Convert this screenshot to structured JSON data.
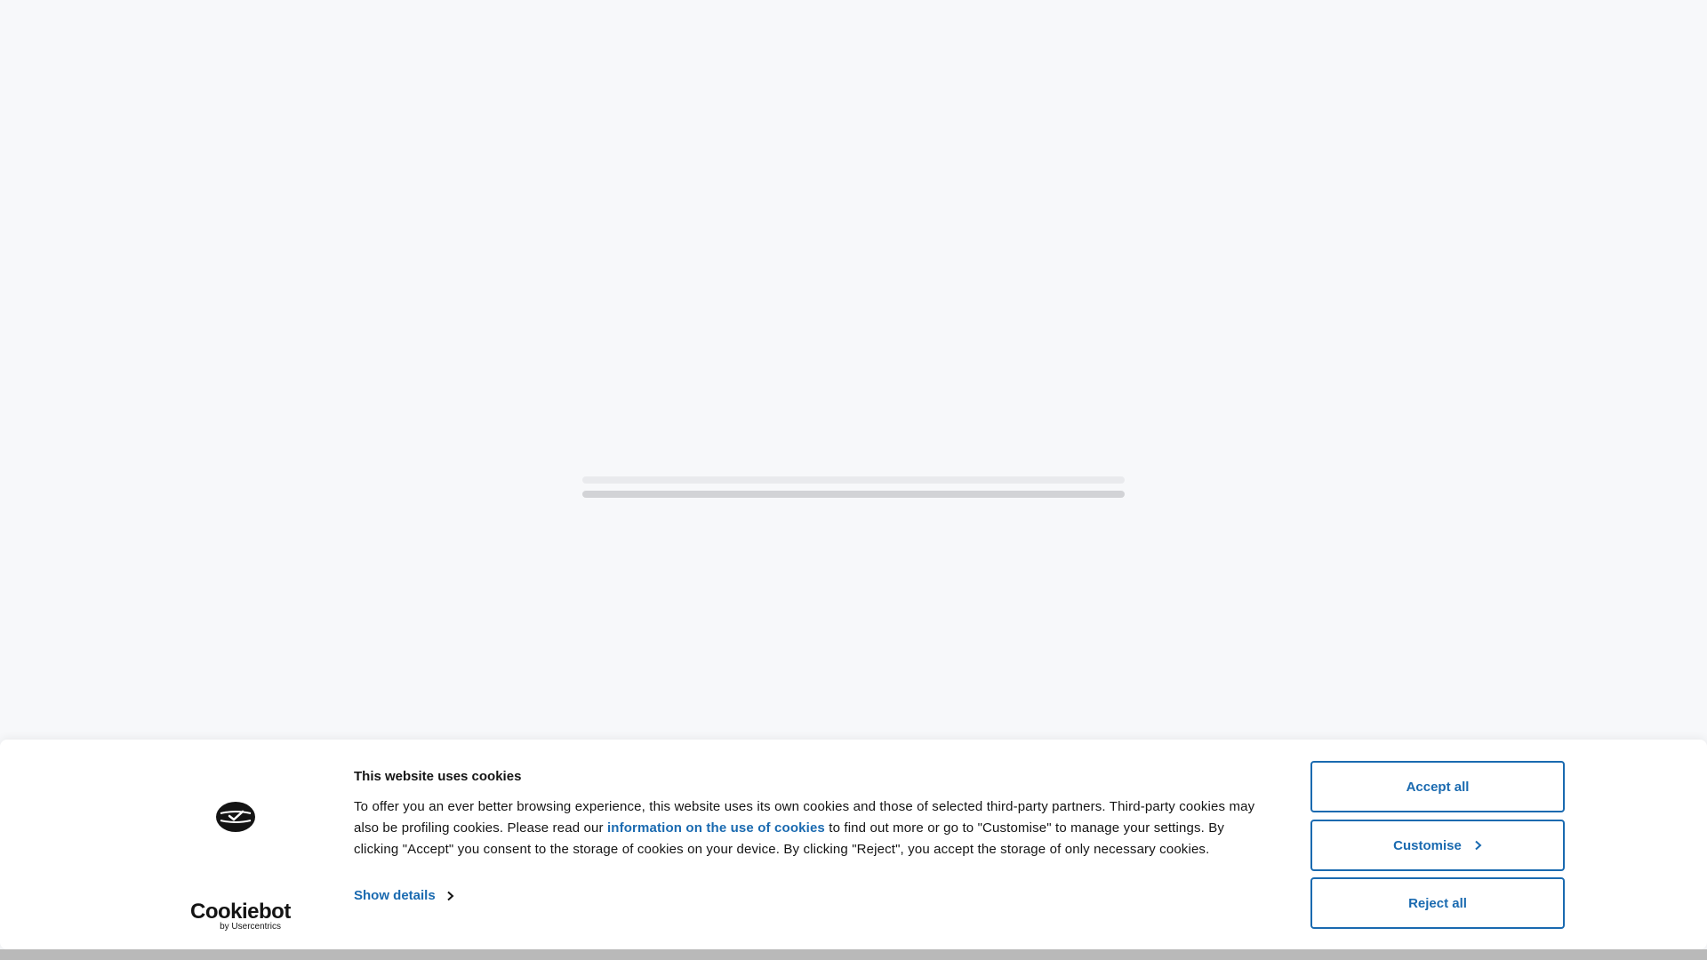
{
  "loader": {
    "bars": [
      "light",
      "dark"
    ]
  },
  "cookie_banner": {
    "title": "This website uses cookies",
    "body_part1": "To offer you an ever better browsing experience, this website uses its own cookies and those of selected third-party partners. Third-party cookies may also be profiling cookies. Please read our ",
    "link_text": "information on the use of cookies",
    "body_part2": " to find out more or go to \"Customise\" to manage your settings. By clicking \"Accept\" you consent to the storage of cookies on your device. By clicking \"Reject\", you accept the storage of only necessary cookies.",
    "show_details_label": "Show details",
    "brand_name": "Cookiebot",
    "brand_sub": "by Usercentrics",
    "buttons": {
      "accept": "Accept all",
      "customise": "Customise",
      "reject": "Reject all"
    }
  },
  "icons": {
    "site_logo": "site-logo-icon",
    "chevron": "chevron-right-icon"
  },
  "colors": {
    "accent": "#1a6ab0",
    "page_background": "#f7f8fa",
    "banner_background": "#ffffff",
    "text": "#141414"
  }
}
